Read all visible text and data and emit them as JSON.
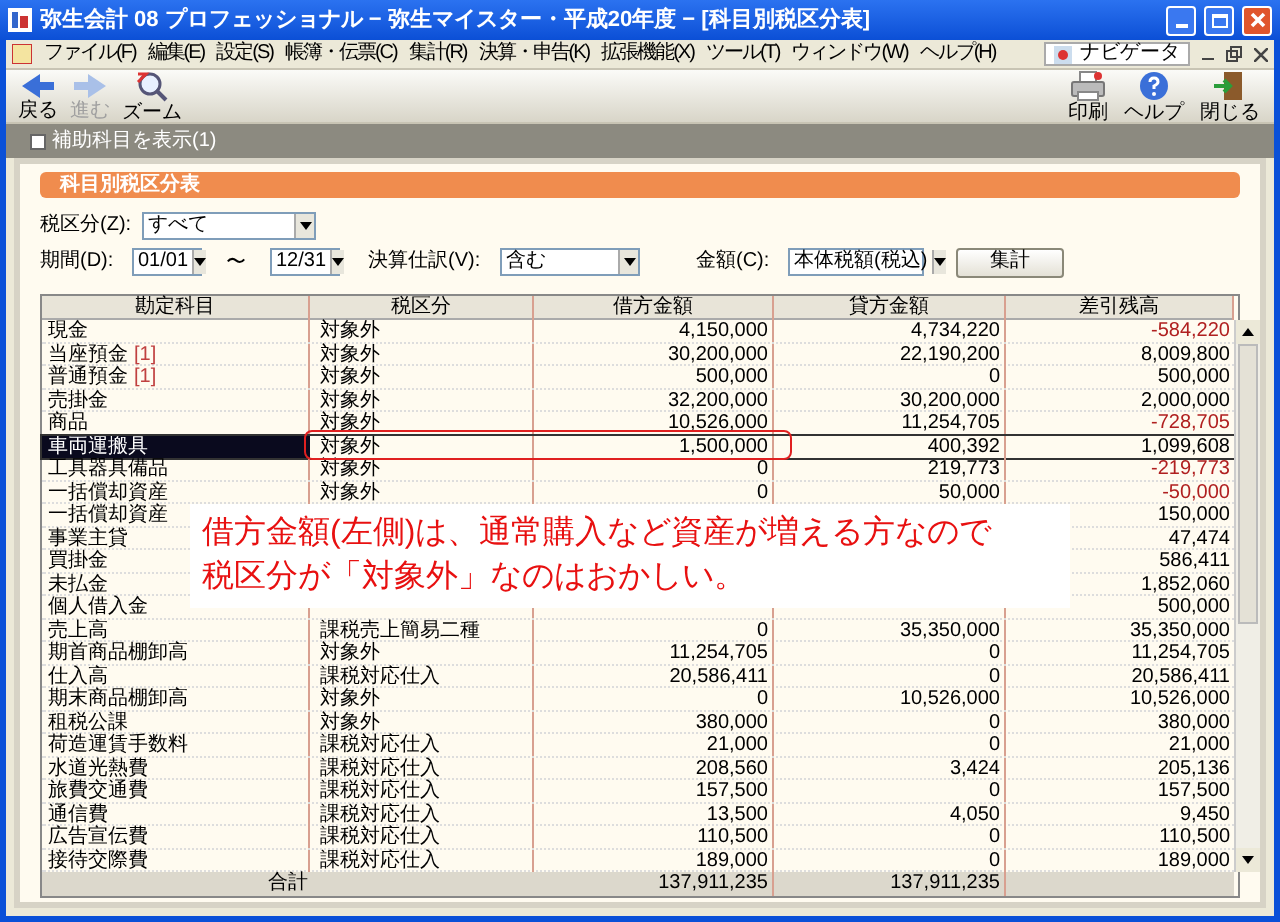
{
  "window": {
    "title": "弥生会計 08 プロフェッショナル − 弥生マイスター・平成20年度 − [科目別税区分表]"
  },
  "menu": [
    "ファイル(F)",
    "編集(E)",
    "設定(S)",
    "帳簿・伝票(C)",
    "集計(R)",
    "決算・申告(K)",
    "拡張機能(X)",
    "ツール(T)",
    "ウィンドウ(W)",
    "ヘルプ(H)"
  ],
  "navigator": "ナビゲータ",
  "toolbar_left": [
    {
      "label": "戻る",
      "kind": "back",
      "disabled": false
    },
    {
      "label": "進む",
      "kind": "forward",
      "disabled": true
    },
    {
      "label": "ズーム",
      "kind": "zoom",
      "disabled": false
    }
  ],
  "toolbar_right": [
    {
      "label": "印刷",
      "kind": "print"
    },
    {
      "label": "ヘルプ",
      "kind": "help"
    },
    {
      "label": "閉じる",
      "kind": "close"
    }
  ],
  "show_sub_accounts": {
    "label": "補助科目を表示(1)",
    "checked": false
  },
  "panel_title": "科目別税区分表",
  "filters": {
    "tax_class_label": "税区分(Z):",
    "tax_class": "すべて",
    "period_label": "期間(D):",
    "from": "01/01",
    "to": "12/31",
    "tilde": "〜",
    "closing_label": "決算仕訳(V):",
    "closing": "含む",
    "amount_label": "金額(C):",
    "amount": "本体税額(税込)",
    "button": "集計"
  },
  "columns": [
    "勘定科目",
    "税区分",
    "借方金額",
    "貸方金額",
    "差引残高"
  ],
  "rows": [
    {
      "account": "現金",
      "tax": "対象外",
      "debit": "4,150,000",
      "credit": "4,734,220",
      "balance": "-584,220",
      "negative": true,
      "selected": false
    },
    {
      "account": "当座預金",
      "sub": "[1]",
      "tax": "対象外",
      "debit": "30,200,000",
      "credit": "22,190,200",
      "balance": "8,009,800",
      "negative": false,
      "selected": false
    },
    {
      "account": "普通預金",
      "sub": "[1]",
      "tax": "対象外",
      "debit": "500,000",
      "credit": "0",
      "balance": "500,000",
      "negative": false,
      "selected": false
    },
    {
      "account": "売掛金",
      "tax": "対象外",
      "debit": "32,200,000",
      "credit": "30,200,000",
      "balance": "2,000,000",
      "negative": false,
      "selected": false
    },
    {
      "account": "商品",
      "tax": "対象外",
      "debit": "10,526,000",
      "credit": "11,254,705",
      "balance": "-728,705",
      "negative": true,
      "selected": false
    },
    {
      "account": "車両運搬具",
      "tax": "対象外",
      "debit": "1,500,000",
      "credit": "400,392",
      "balance": "1,099,608",
      "negative": false,
      "selected": true
    },
    {
      "account": "工具器具備品",
      "tax": "対象外",
      "debit": "0",
      "credit": "219,773",
      "balance": "-219,773",
      "negative": true,
      "selected": false
    },
    {
      "account": "一括償却資産",
      "tax": "対象外",
      "debit": "0",
      "credit": "50,000",
      "balance": "-50,000",
      "negative": true,
      "selected": false
    },
    {
      "account": "一括償却資産",
      "balance": "150,000",
      "negative": false,
      "selected": false
    },
    {
      "account": "事業主貸",
      "balance": "47,474",
      "negative": false,
      "selected": false
    },
    {
      "account": "買掛金",
      "balance": "586,411",
      "negative": false,
      "selected": false
    },
    {
      "account": "未払金",
      "balance": "1,852,060",
      "negative": false,
      "selected": false
    },
    {
      "account": "個人借入金",
      "balance": "500,000",
      "negative": false,
      "selected": false
    },
    {
      "account": "売上高",
      "tax": "課税売上簡易二種",
      "debit": "0",
      "credit": "35,350,000",
      "balance": "35,350,000",
      "negative": false,
      "selected": false
    },
    {
      "account": "期首商品棚卸高",
      "tax": "対象外",
      "debit": "11,254,705",
      "credit": "0",
      "balance": "11,254,705",
      "negative": false,
      "selected": false
    },
    {
      "account": "仕入高",
      "tax": "課税対応仕入",
      "debit": "20,586,411",
      "credit": "0",
      "balance": "20,586,411",
      "negative": false,
      "selected": false
    },
    {
      "account": "期末商品棚卸高",
      "tax": "対象外",
      "debit": "0",
      "credit": "10,526,000",
      "balance": "10,526,000",
      "negative": false,
      "selected": false
    },
    {
      "account": "租税公課",
      "tax": "対象外",
      "debit": "380,000",
      "credit": "0",
      "balance": "380,000",
      "negative": false,
      "selected": false
    },
    {
      "account": "荷造運賃手数料",
      "tax": "課税対応仕入",
      "debit": "21,000",
      "credit": "0",
      "balance": "21,000",
      "negative": false,
      "selected": false
    },
    {
      "account": "水道光熱費",
      "tax": "課税対応仕入",
      "debit": "208,560",
      "credit": "3,424",
      "balance": "205,136",
      "negative": false,
      "selected": false
    },
    {
      "account": "旅費交通費",
      "tax": "課税対応仕入",
      "debit": "157,500",
      "credit": "0",
      "balance": "157,500",
      "negative": false,
      "selected": false
    },
    {
      "account": "通信費",
      "tax": "課税対応仕入",
      "debit": "13,500",
      "credit": "4,050",
      "balance": "9,450",
      "negative": false,
      "selected": false
    },
    {
      "account": "広告宣伝費",
      "tax": "課税対応仕入",
      "debit": "110,500",
      "credit": "0",
      "balance": "110,500",
      "negative": false,
      "selected": false
    },
    {
      "account": "接待交際費",
      "tax": "課税対応仕入",
      "debit": "189,000",
      "credit": "0",
      "balance": "189,000",
      "negative": false,
      "selected": false
    }
  ],
  "total": {
    "label": "合計",
    "debit": "137,911,235",
    "credit": "137,911,235"
  },
  "callout": [
    "借方金額(左側)は、通常購入など資産が増える方なので",
    "税区分が「対象外」なのはおかしい。"
  ]
}
